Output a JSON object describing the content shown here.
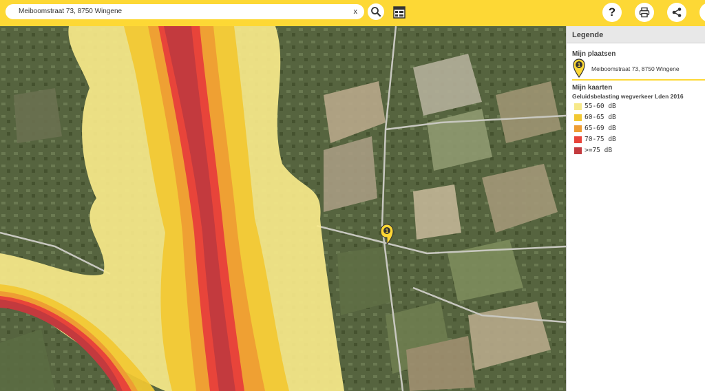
{
  "search": {
    "value": "Meiboomstraat 73, 8750 Wingene",
    "clear_label": "x"
  },
  "toolbar": {
    "help_label": "?"
  },
  "legend": {
    "header": "Legende",
    "places_title": "Mijn plaatsen",
    "place_label": "Meiboomstraat 73, 8750 Wingene",
    "place_marker": "1",
    "maps_title": "Mijn kaarten",
    "layer_title": "Geluidsbelasting wegverkeer Lden 2016",
    "items": [
      {
        "label": "55-60 dB",
        "color": "#f7e98a"
      },
      {
        "label": "60-65 dB",
        "color": "#f2c832"
      },
      {
        "label": "65-69 dB",
        "color": "#ee9d33"
      },
      {
        "label": "70-75 dB",
        "color": "#e8443a"
      },
      {
        "label": ">=75 dB",
        "color": "#c33a3e"
      }
    ]
  },
  "map": {
    "marker_label": "1"
  },
  "colors": {
    "accent": "#fdd835"
  }
}
